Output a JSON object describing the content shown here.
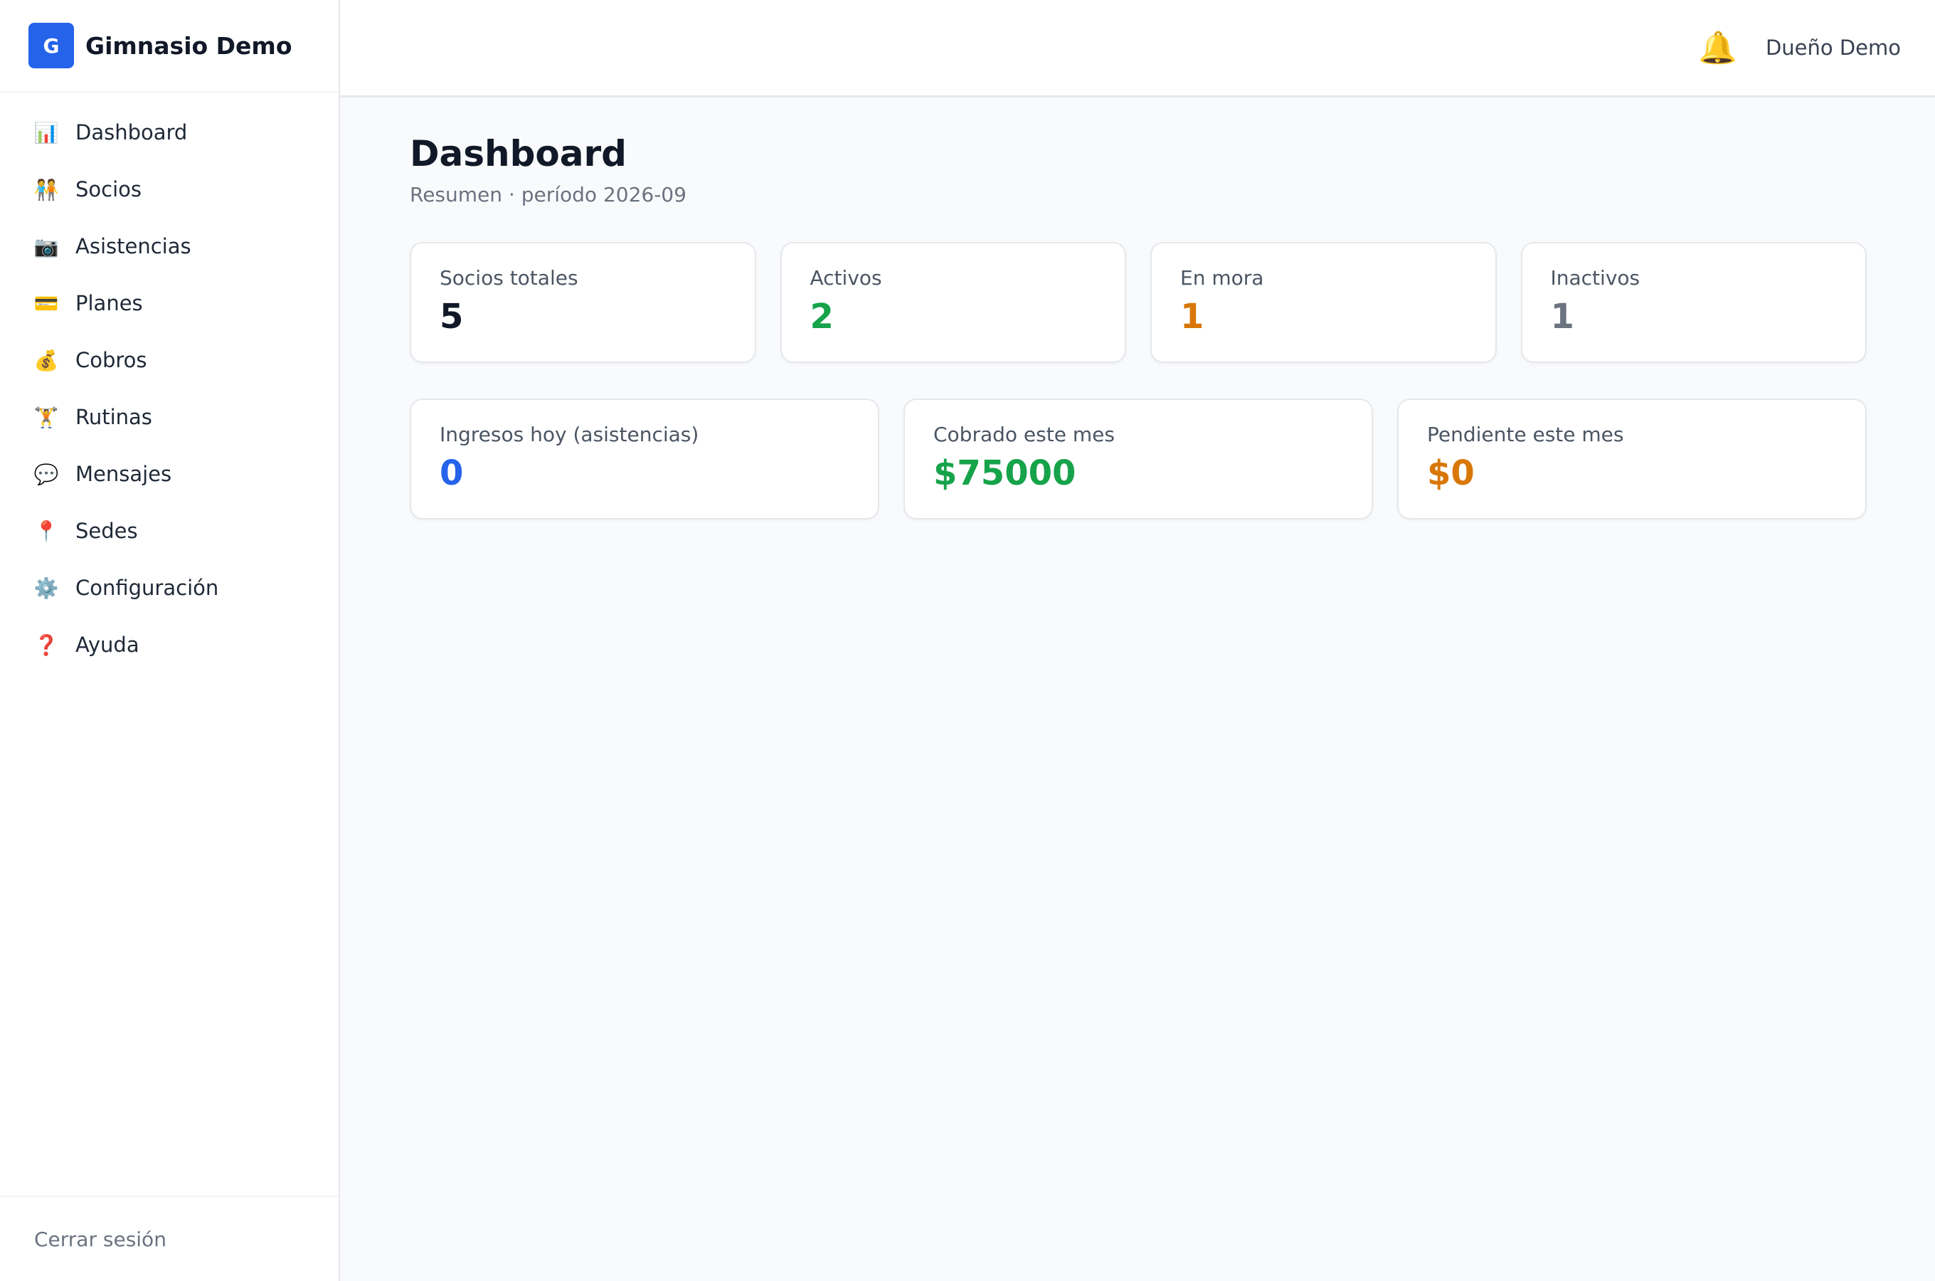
{
  "brand": {
    "logo_letter": "G",
    "name": "Gimnasio Demo",
    "logo_color": "#2563eb"
  },
  "sidebar": {
    "items": [
      {
        "label": "Dashboard",
        "icon": "📊",
        "icon_name": "bar-chart-icon"
      },
      {
        "label": "Socios",
        "icon": "🧑‍🤝‍🧑",
        "icon_name": "people-icon"
      },
      {
        "label": "Asistencias",
        "icon": "📷",
        "icon_name": "camera-icon"
      },
      {
        "label": "Planes",
        "icon": "💳",
        "icon_name": "credit-card-icon"
      },
      {
        "label": "Cobros",
        "icon": "💰",
        "icon_name": "money-bag-icon"
      },
      {
        "label": "Rutinas",
        "icon": "🏋️",
        "icon_name": "weightlifter-icon"
      },
      {
        "label": "Mensajes",
        "icon": "💬",
        "icon_name": "speech-bubble-icon"
      },
      {
        "label": "Sedes",
        "icon": "📍",
        "icon_name": "location-pin-icon"
      },
      {
        "label": "Configuración",
        "icon": "⚙️",
        "icon_name": "gear-icon"
      },
      {
        "label": "Ayuda",
        "icon": "❓",
        "icon_name": "question-icon"
      }
    ],
    "logout_label": "Cerrar sesión"
  },
  "header": {
    "bell_icon": "🔔",
    "user_name": "Dueño Demo"
  },
  "main": {
    "title": "Dashboard",
    "subtitle": "Resumen · período 2026-09",
    "stats_row1": [
      {
        "label": "Socios totales",
        "value": "5",
        "color": "#111827"
      },
      {
        "label": "Activos",
        "value": "2",
        "color": "#16a34a"
      },
      {
        "label": "En mora",
        "value": "1",
        "color": "#d97706"
      },
      {
        "label": "Inactivos",
        "value": "1",
        "color": "#6b7280"
      }
    ],
    "stats_row2": [
      {
        "label": "Ingresos hoy (asistencias)",
        "value": "0",
        "color": "#2563eb"
      },
      {
        "label": "Cobrado este mes",
        "value": "$75000",
        "color": "#16a34a"
      },
      {
        "label": "Pendiente este mes",
        "value": "$0",
        "color": "#d97706"
      }
    ]
  }
}
